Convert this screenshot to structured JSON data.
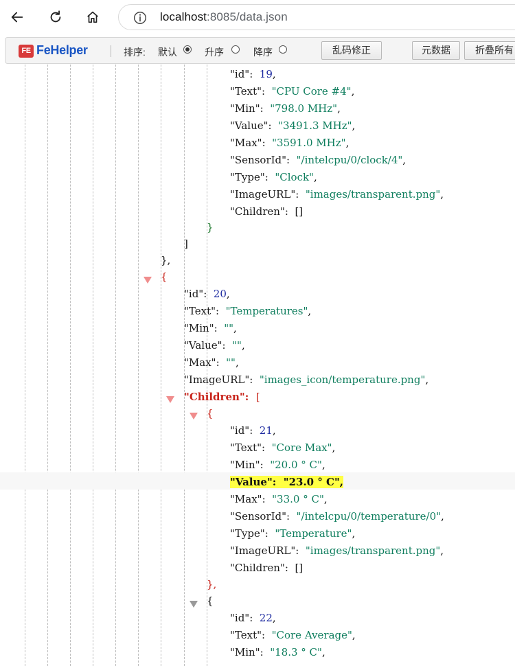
{
  "browser": {
    "url_host": "localhost",
    "url_rest": ":8085/data.json"
  },
  "toolbar": {
    "brand": "FeHelper",
    "sort_label": "排序:",
    "sort_default": "默认",
    "sort_asc": "升序",
    "sort_desc": "降序",
    "selected_sort": "默认",
    "fix_encoding_button": "乱码修正",
    "metadata_button": "元数据",
    "collapse_all_button": "折叠所有"
  },
  "json_lines": [
    {
      "k": "\"id\"",
      "v": "19",
      "t": "n"
    },
    {
      "k": "\"Text\"",
      "v": "\"CPU Core #4\"",
      "t": "s"
    },
    {
      "k": "\"Min\"",
      "v": "\"798.0 MHz\"",
      "t": "s"
    },
    {
      "k": "\"Value\"",
      "v": "\"3491.3 MHz\"",
      "t": "s"
    },
    {
      "k": "\"Max\"",
      "v": "\"3591.0 MHz\"",
      "t": "s"
    },
    {
      "k": "\"SensorId\"",
      "v": "\"/intelcpu/0/clock/4\"",
      "t": "s"
    },
    {
      "k": "\"Type\"",
      "v": "\"Clock\"",
      "t": "s"
    },
    {
      "k": "\"ImageURL\"",
      "v": "\"images/transparent.png\"",
      "t": "s"
    },
    {
      "k": "\"Children\"",
      "v": "[]",
      "t": "p"
    },
    {
      "k": "\"id\"",
      "v": "20",
      "t": "n"
    },
    {
      "k": "\"Text\"",
      "v": "\"Temperatures\"",
      "t": "s"
    },
    {
      "k": "\"Min\"",
      "v": "\"\"",
      "t": "s"
    },
    {
      "k": "\"Value\"",
      "v": "\"\"",
      "t": "s"
    },
    {
      "k": "\"Max\"",
      "v": "\"\"",
      "t": "s"
    },
    {
      "k": "\"ImageURL\"",
      "v": "\"images_icon/temperature.png\"",
      "t": "s"
    },
    {
      "k": "\"Children\"",
      "v": "[",
      "t": "r"
    },
    {
      "k": "\"id\"",
      "v": "21",
      "t": "n"
    },
    {
      "k": "\"Text\"",
      "v": "\"Core Max\"",
      "t": "s"
    },
    {
      "k": "\"Min\"",
      "v": "\"20.0 ° C\"",
      "t": "s"
    },
    {
      "k": "\"Value\"",
      "v": "\"23.0 ° C\"",
      "t": "s"
    },
    {
      "k": "\"Max\"",
      "v": "\"33.0 ° C\"",
      "t": "s"
    },
    {
      "k": "\"SensorId\"",
      "v": "\"/intelcpu/0/temperature/0\"",
      "t": "s"
    },
    {
      "k": "\"Type\"",
      "v": "\"Temperature\"",
      "t": "s"
    },
    {
      "k": "\"ImageURL\"",
      "v": "\"images/transparent.png\"",
      "t": "s"
    },
    {
      "k": "\"Children\"",
      "v": "[]",
      "t": "p"
    },
    {
      "k": "\"id\"",
      "v": "22",
      "t": "n"
    },
    {
      "k": "\"Text\"",
      "v": "\"Core Average\"",
      "t": "s"
    },
    {
      "k": "\"Min\"",
      "v": "\"18.3 ° C\"",
      "t": "s"
    }
  ],
  "brackets": {
    "obj_close": "}",
    "arr_close": "]",
    "obj_close_comma": "},",
    "obj_open": "{"
  },
  "colors": {
    "string": "#0f7e5e",
    "number": "#1d2aa0",
    "highlight": "#ffff44",
    "brand": "#1a56c4",
    "logo": "#d83a3a"
  }
}
